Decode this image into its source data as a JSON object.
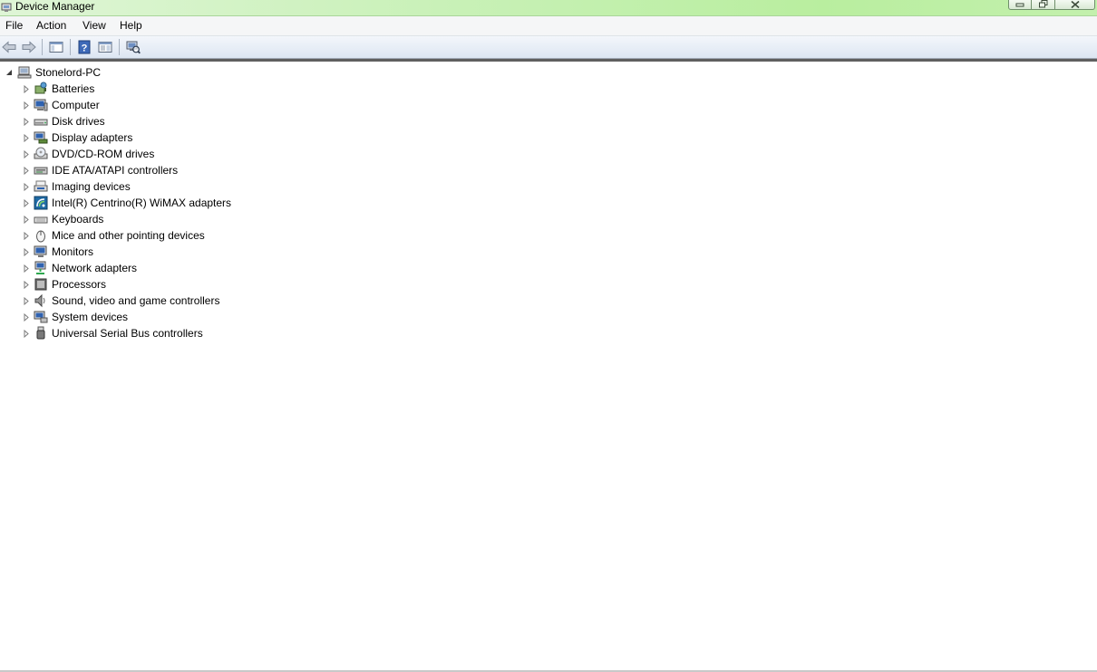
{
  "window": {
    "title": "Device Manager"
  },
  "menu": [
    "File",
    "Action",
    "View",
    "Help"
  ],
  "toolbar": {
    "buttons": [
      {
        "icon": "back-arrow-icon"
      },
      {
        "icon": "forward-arrow-icon"
      },
      {
        "icon": "show-hide-console-tree-icon"
      },
      {
        "icon": "help-icon"
      },
      {
        "icon": "properties-pane-icon"
      },
      {
        "icon": "scan-hardware-changes-icon"
      }
    ]
  },
  "tree": {
    "root": {
      "label": "Stonelord-PC",
      "icon": "computer-root-icon",
      "expanded": true
    },
    "categories": [
      {
        "label": "Batteries",
        "icon": "battery-icon"
      },
      {
        "label": "Computer",
        "icon": "computer-icon"
      },
      {
        "label": "Disk drives",
        "icon": "disk-drive-icon"
      },
      {
        "label": "Display adapters",
        "icon": "display-adapter-icon"
      },
      {
        "label": "DVD/CD-ROM drives",
        "icon": "dvd-drive-icon"
      },
      {
        "label": "IDE ATA/ATAPI controllers",
        "icon": "ide-controller-icon"
      },
      {
        "label": "Imaging devices",
        "icon": "imaging-device-icon"
      },
      {
        "label": "Intel(R) Centrino(R) WiMAX adapters",
        "icon": "wimax-adapter-icon"
      },
      {
        "label": "Keyboards",
        "icon": "keyboard-icon"
      },
      {
        "label": "Mice and other pointing devices",
        "icon": "mouse-icon"
      },
      {
        "label": "Monitors",
        "icon": "monitor-icon"
      },
      {
        "label": "Network adapters",
        "icon": "network-adapter-icon"
      },
      {
        "label": "Processors",
        "icon": "processor-icon"
      },
      {
        "label": "Sound, video and game controllers",
        "icon": "speaker-icon"
      },
      {
        "label": "System devices",
        "icon": "system-devices-icon"
      },
      {
        "label": "Universal Serial Bus controllers",
        "icon": "usb-icon"
      }
    ]
  },
  "colors": {
    "title_gradient_start": "#dff5d6",
    "title_gradient_end": "#b9ee9f",
    "toolbar_top": "#f3f6fb",
    "toolbar_bottom": "#dde6f2"
  }
}
